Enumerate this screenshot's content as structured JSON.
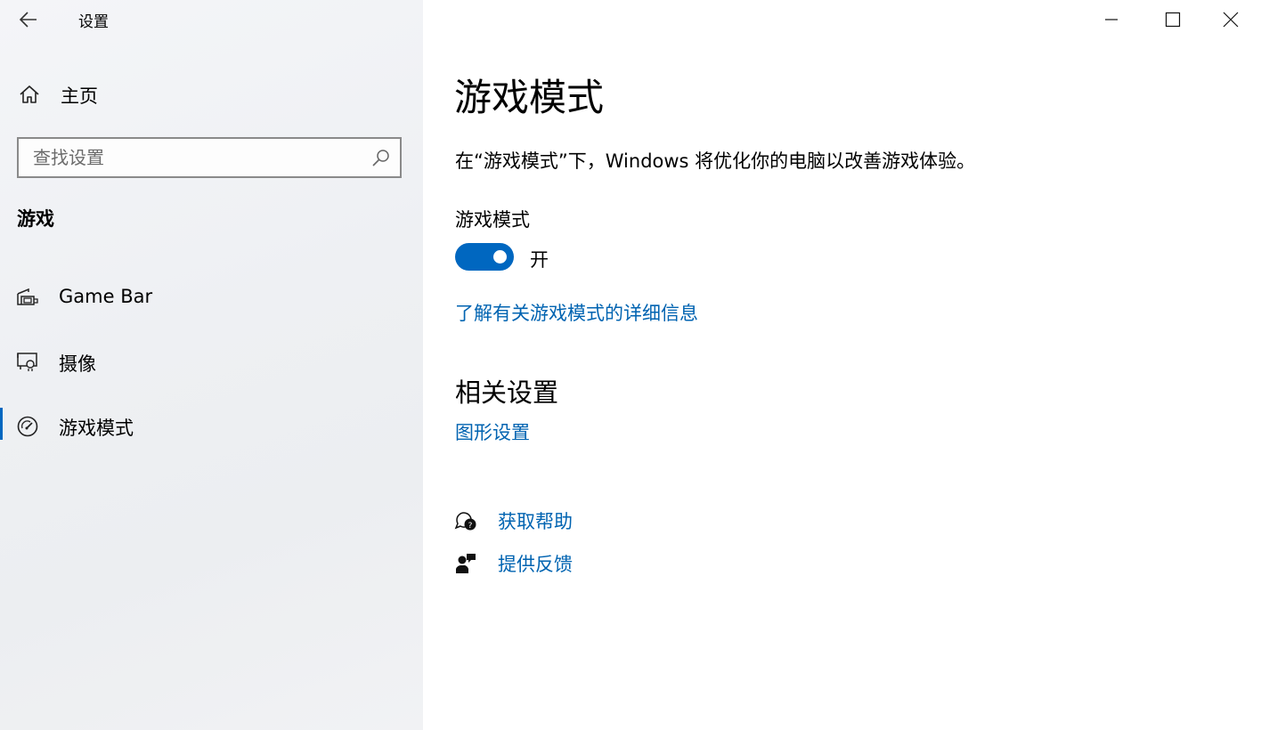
{
  "window": {
    "title": "设置"
  },
  "sidebar": {
    "home_label": "主页",
    "search_placeholder": "查找设置",
    "section_title": "游戏",
    "items": [
      {
        "label": "Game Bar",
        "icon": "game-bar-icon"
      },
      {
        "label": "摄像",
        "icon": "captures-icon"
      },
      {
        "label": "游戏模式",
        "icon": "game-mode-icon",
        "selected": true
      }
    ]
  },
  "main": {
    "title": "游戏模式",
    "description": "在“游戏模式”下，Windows 将优化你的电脑以改善游戏体验。",
    "setting_label": "游戏模式",
    "toggle": {
      "on": true,
      "state_label": "开"
    },
    "learn_more_link": "了解有关游戏模式的详细信息",
    "related_title": "相关设置",
    "related_link": "图形设置",
    "help_link": "获取帮助",
    "feedback_link": "提供反馈"
  },
  "colors": {
    "accent": "#0067c0",
    "link": "#0063b1"
  }
}
